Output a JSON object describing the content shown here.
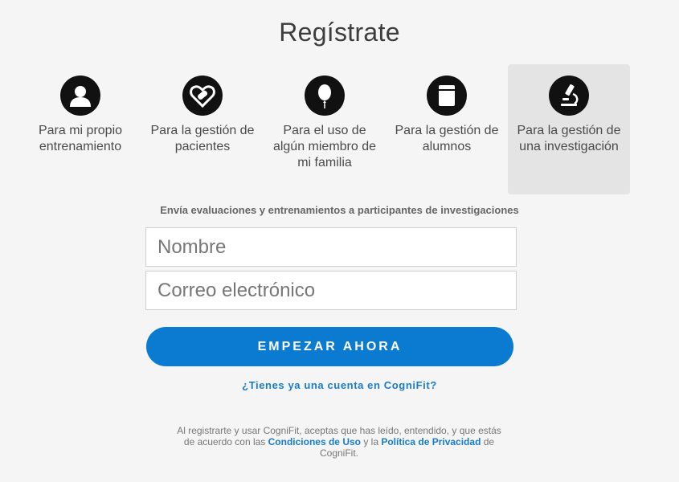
{
  "title": "Regístrate",
  "options": [
    {
      "label": "Para mi propio entrenamiento",
      "icon": "user-icon",
      "selected": false
    },
    {
      "label": "Para la gestión de pacientes",
      "icon": "heart-bandage-icon",
      "selected": false
    },
    {
      "label": "Para el uso de algún miembro de mi familia",
      "icon": "balloon-icon",
      "selected": false
    },
    {
      "label": "Para la gestión de alumnos",
      "icon": "notebook-icon",
      "selected": false
    },
    {
      "label": "Para la gestión de una investigación",
      "icon": "microscope-icon",
      "selected": true
    }
  ],
  "subtitle": "Envía evaluaciones y entrenamientos a participantes de investigaciones",
  "form": {
    "name_placeholder": "Nombre",
    "email_placeholder": "Correo electrónico",
    "submit_label": "EMPEZAR AHORA"
  },
  "login_link": "¿Tienes ya una cuenta en CogniFit?",
  "terms": {
    "prefix": "Al registrarte y usar CogniFit, aceptas que has leído, entendido, y que estás de acuerdo con las ",
    "terms_link": "Condiciones de Uso",
    "middle": " y la ",
    "privacy_link": "Política de Privacidad",
    "suffix": " de CogniFit."
  },
  "colors": {
    "accent": "#0a7bd1",
    "link": "#1a7cc7",
    "selected_tile": "#e4e4e4"
  }
}
